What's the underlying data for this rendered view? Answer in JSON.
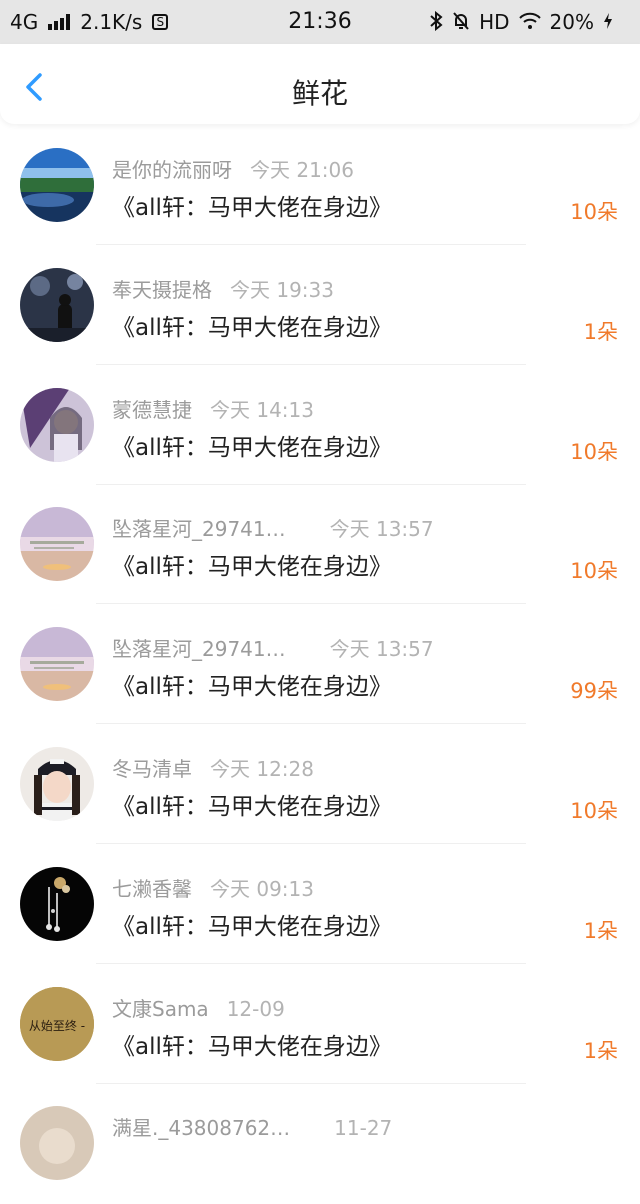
{
  "status_bar": {
    "network": "4G",
    "speed": "2.1K/s",
    "sim_icon": "S",
    "time": "21:36",
    "hd": "HD",
    "battery": "20%",
    "icons": [
      "signal-bars-icon",
      "sim-icon",
      "bluetooth-icon",
      "mute-bell-icon",
      "wifi-icon",
      "charging-icon"
    ]
  },
  "header": {
    "title": "鲜花",
    "back_icon": "back-chevron-icon"
  },
  "colors": {
    "accent": "#2f9bff",
    "count": "#f07a2b",
    "meta": "#9b9b9b"
  },
  "items": [
    {
      "user": "是你的流丽呀",
      "time": "今天 21:06",
      "book": "《all轩：马甲大佬在身边》",
      "count": "10朵",
      "avatar": "landscape-sky"
    },
    {
      "user": "奉天摄提格",
      "time": "今天 19:33",
      "book": "《all轩：马甲大佬在身边》",
      "count": "1朵",
      "avatar": "night-figure"
    },
    {
      "user": "蒙德慧捷",
      "time": "今天 14:13",
      "book": "《all轩：马甲大佬在身边》",
      "count": "10朵",
      "avatar": "anime-umbrella"
    },
    {
      "user": "坠落星河_29741…",
      "time": "今天 13:57",
      "book": "《all轩：马甲大佬在身边》",
      "count": "10朵",
      "avatar": "pastel-sunset"
    },
    {
      "user": "坠落星河_29741…",
      "time": "今天 13:57",
      "book": "《all轩：马甲大佬在身边》",
      "count": "99朵",
      "avatar": "pastel-sunset"
    },
    {
      "user": "冬马清卓",
      "time": "今天 12:28",
      "book": "《all轩：马甲大佬在身边》",
      "count": "10朵",
      "avatar": "girl-cap"
    },
    {
      "user": "七濑香馨",
      "time": "今天 09:13",
      "book": "《all轩：马甲大佬在身边》",
      "count": "1朵",
      "avatar": "hairpin-dark"
    },
    {
      "user": "文康Sama",
      "time": "12-09",
      "book": "《all轩：马甲大佬在身边》",
      "count": "1朵",
      "avatar": "text-badge",
      "avatar_text": "从始至终 -"
    },
    {
      "user": "满星._43808762…",
      "time": "11-27",
      "book": "",
      "count": "",
      "avatar": "partial"
    }
  ]
}
